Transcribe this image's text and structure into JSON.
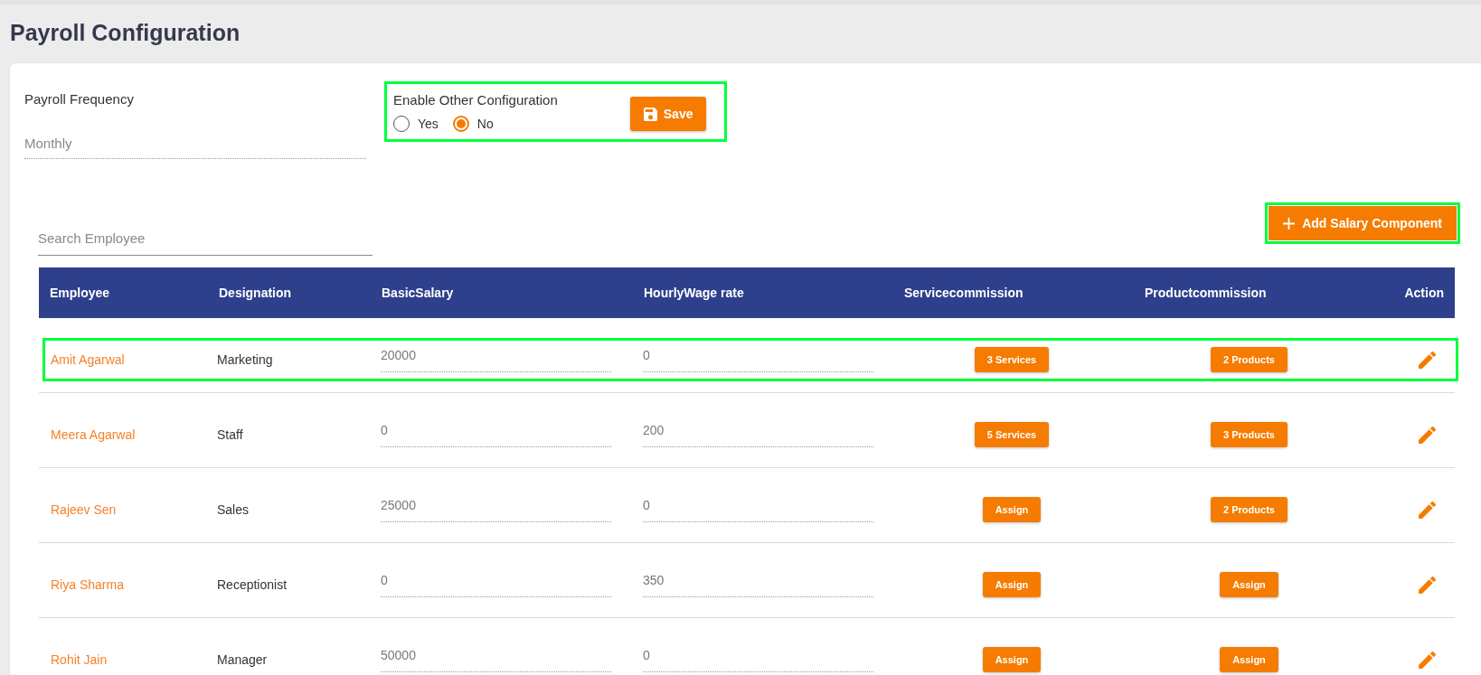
{
  "page": {
    "title": "Payroll Configuration"
  },
  "payroll_frequency": {
    "label": "Payroll Frequency",
    "value": "Monthly"
  },
  "other_configuration": {
    "label": "Enable Other Configuration",
    "highlighted": true,
    "options": [
      {
        "label": "Yes",
        "selected": false
      },
      {
        "label": "No",
        "selected": true
      }
    ],
    "save_button": "Save"
  },
  "search": {
    "placeholder": "Search Employee"
  },
  "add_button": {
    "label": "Add Salary Component",
    "highlighted": true
  },
  "table": {
    "columns": [
      "Employee",
      "Designation",
      "BasicSalary",
      "HourlyWage rate",
      "Servicecommission",
      "Productcommission",
      "Action"
    ],
    "rows": [
      {
        "employee": "Amit Agarwal",
        "designation": "Marketing",
        "basic_salary": "20000",
        "hourly_wage_rate": "0",
        "service_commission": "3 Services",
        "product_commission": "2 Products",
        "highlighted": true
      },
      {
        "employee": "Meera Agarwal",
        "designation": "Staff",
        "basic_salary": "0",
        "hourly_wage_rate": "200",
        "service_commission": "5 Services",
        "product_commission": "3 Products",
        "highlighted": false
      },
      {
        "employee": "Rajeev Sen",
        "designation": "Sales",
        "basic_salary": "25000",
        "hourly_wage_rate": "0",
        "service_commission": "Assign",
        "product_commission": "2 Products",
        "highlighted": false
      },
      {
        "employee": "Riya Sharma",
        "designation": "Receptionist",
        "basic_salary": "0",
        "hourly_wage_rate": "350",
        "service_commission": "Assign",
        "product_commission": "Assign",
        "highlighted": false
      },
      {
        "employee": "Rohit Jain",
        "designation": "Manager",
        "basic_salary": "50000",
        "hourly_wage_rate": "0",
        "service_commission": "Assign",
        "product_commission": "Assign",
        "highlighted": false
      }
    ]
  }
}
